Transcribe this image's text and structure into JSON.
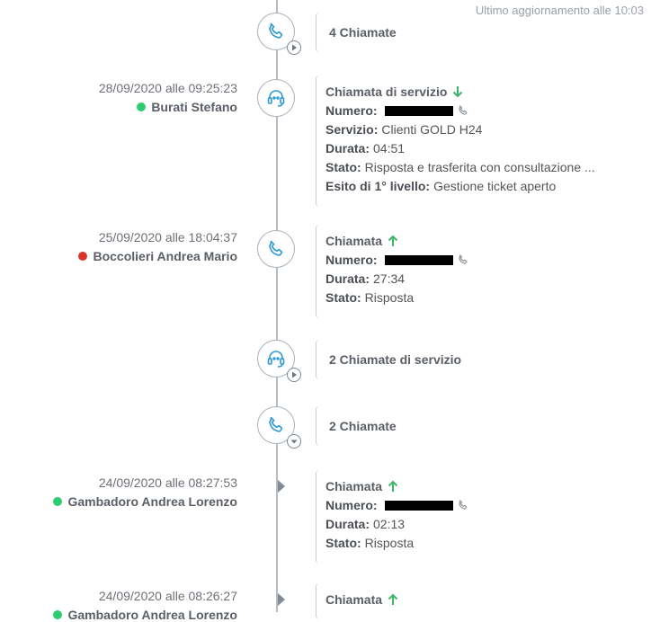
{
  "last_update": "Ultimo aggiornamento alle 10:03",
  "colors": {
    "icon_blue": "#2f9ad6",
    "arrow_green": "#3fb56b",
    "status_green": "#2ecc71",
    "status_red": "#d9342b"
  },
  "groups": [
    {
      "label": "4 Chiamate",
      "icon": "phone-icon",
      "badge": "play-icon"
    },
    {
      "label": "2 Chiamate di servizio",
      "icon": "headset-icon",
      "badge": "play-icon"
    },
    {
      "label": "2 Chiamate",
      "icon": "phone-icon",
      "badge": "chevron-down-icon"
    }
  ],
  "entries": [
    {
      "date": "28/09/2020 alle 09:25:23",
      "person": "Burati Stefano",
      "status": "online",
      "title": "Chiamata di servizio",
      "direction": "down",
      "fields": [
        {
          "key": "Numero:",
          "value": ""
        },
        {
          "key": "Servizio:",
          "value": "Clienti GOLD H24"
        },
        {
          "key": "Durata:",
          "value": "04:51"
        },
        {
          "key": "Stato:",
          "value": "Risposta e trasferita con consultazione ..."
        },
        {
          "key": "Esito di 1° livello:",
          "value": "Gestione ticket aperto"
        }
      ]
    },
    {
      "date": "25/09/2020 alle 18:04:37",
      "person": "Boccolieri Andrea Mario",
      "status": "busy",
      "title": "Chiamata",
      "direction": "up",
      "fields": [
        {
          "key": "Numero:",
          "value": ""
        },
        {
          "key": "Durata:",
          "value": "27:34"
        },
        {
          "key": "Stato:",
          "value": "Risposta"
        }
      ]
    },
    {
      "date": "24/09/2020 alle 08:27:53",
      "person": "Gambadoro Andrea Lorenzo",
      "status": "online",
      "title": "Chiamata",
      "direction": "up",
      "fields": [
        {
          "key": "Numero:",
          "value": ""
        },
        {
          "key": "Durata:",
          "value": "02:13"
        },
        {
          "key": "Stato:",
          "value": "Risposta"
        }
      ]
    },
    {
      "date": "24/09/2020 alle 08:26:27",
      "person": "Gambadoro Andrea Lorenzo",
      "status": "online",
      "title": "Chiamata",
      "direction": "up",
      "fields": []
    }
  ]
}
